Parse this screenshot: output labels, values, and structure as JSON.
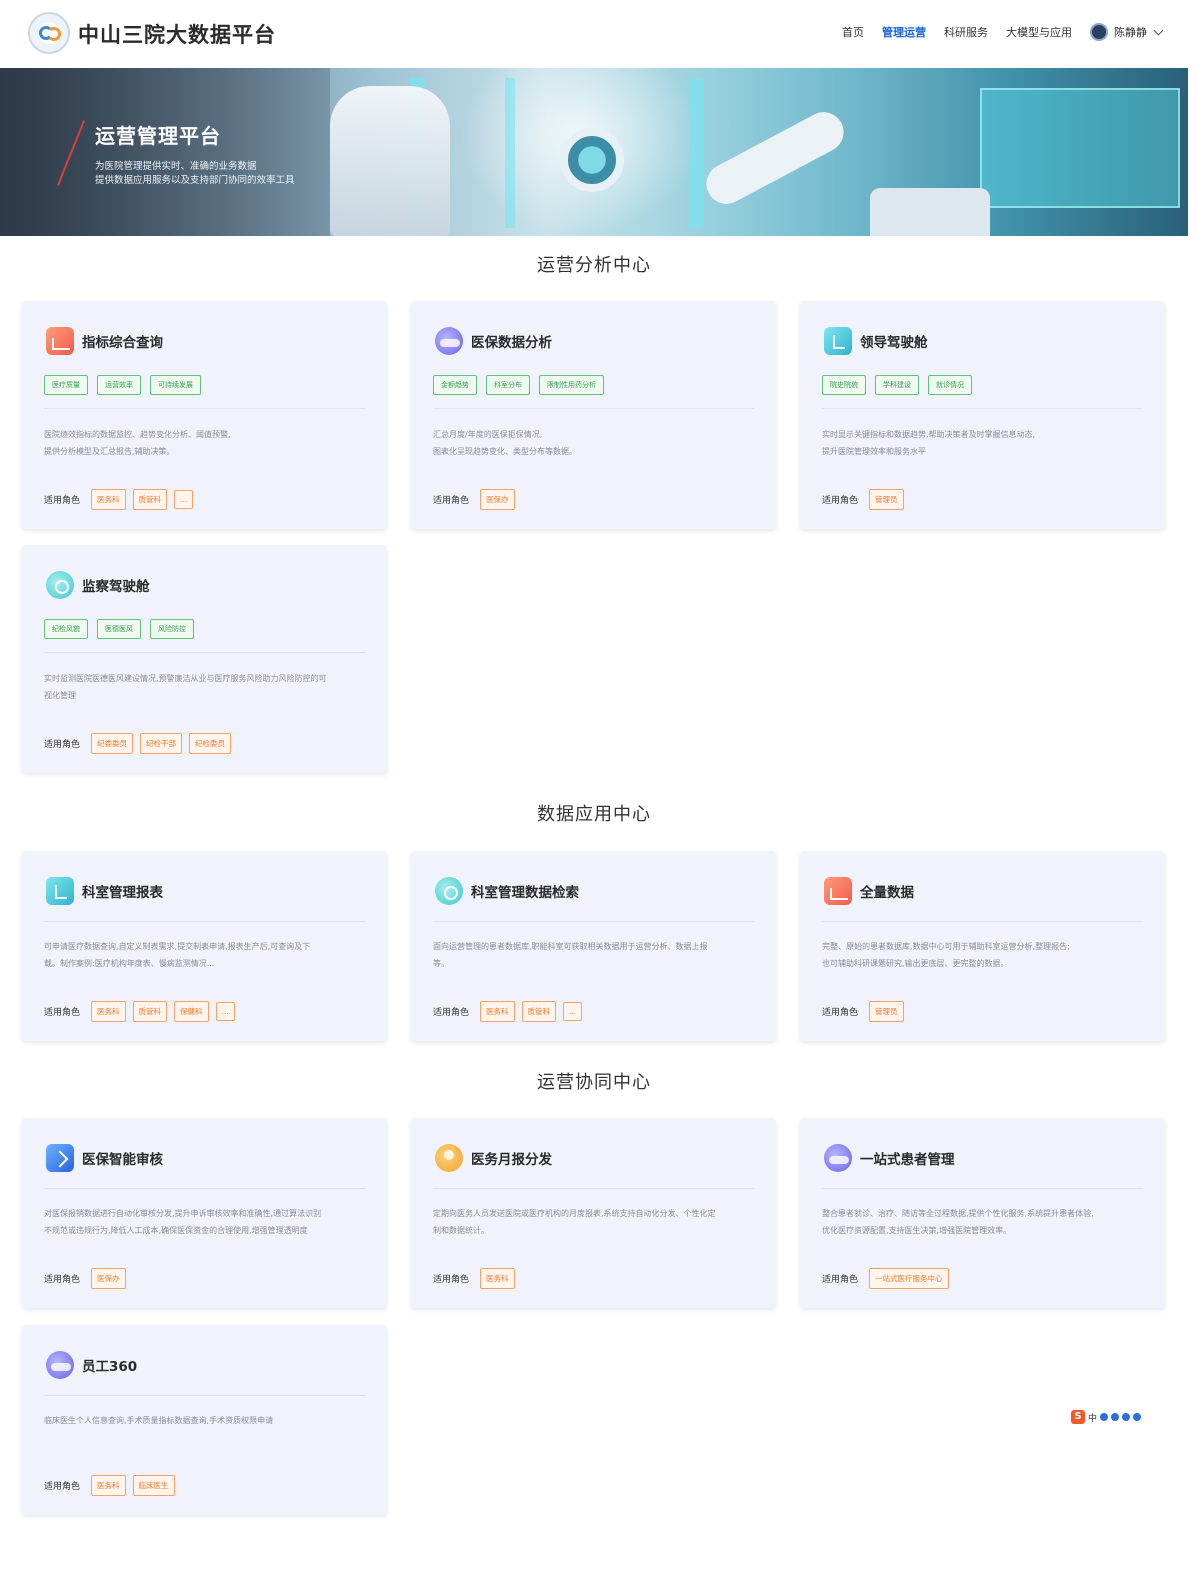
{
  "header": {
    "app_title": "中山三院大数据平台",
    "nav": [
      "首页",
      "管理运营",
      "科研服务",
      "大模型与应用"
    ],
    "active_nav": "管理运营",
    "user_name": "陈静静"
  },
  "banner": {
    "title": "运营管理平台",
    "subtitle_line1": "为医院管理提供实时、准确的业务数据",
    "subtitle_line2": "提供数据应用服务以及支持部门协同的效率工具"
  },
  "roles_label": "适用角色",
  "sections": [
    {
      "title": "运营分析中心",
      "cards": [
        {
          "icon": "chart-icon",
          "title": "指标综合查询",
          "tags": [
            "医疗质量",
            "运营效率",
            "可持续发展"
          ],
          "desc": [
            "医院绩效指标的数据监控、趋势变化分析、阈值预警,",
            "提供分析模型及汇总报告,辅助决策。"
          ],
          "roles": [
            "医务科",
            "质管科",
            "..."
          ]
        },
        {
          "icon": "cloud-icon",
          "title": "医保数据分析",
          "tags": [
            "金额趋势",
            "科室分布",
            "限制性用药分析"
          ],
          "desc": [
            "汇总月度/年度的医保拒保情况,",
            "图表化呈现趋势变化、类型分布等数据。"
          ],
          "roles": [
            "医保办"
          ]
        },
        {
          "icon": "clipboard-icon",
          "title": "领导驾驶舱",
          "tags": [
            "院史院貌",
            "学科建设",
            "就诊情况"
          ],
          "desc": [
            "实时显示关键指标和数据趋势,帮助决策者及时掌握信息动态,",
            "提升医院管理效率和服务水平"
          ],
          "roles": [
            "管理员"
          ]
        },
        {
          "icon": "teal-cloud-icon",
          "title": "监察驾驶舱",
          "tags": [
            "纪检风貌",
            "医德医风",
            "风险防控"
          ],
          "desc": [
            "实时监测医院医德医风建设情况,预警廉洁从业与医疗服务风险助力风险防控的可",
            "视化管理"
          ],
          "roles": [
            "纪委委员",
            "纪检干部",
            "纪检委员"
          ]
        }
      ]
    },
    {
      "title": "数据应用中心",
      "cards": [
        {
          "icon": "clipboard-icon",
          "title": "科室管理报表",
          "desc": [
            "可申请医疗数据查询,自定义制表需求,提交制表申请,报表生产后,可查询及下",
            "载。制作案例:医疗机构年度表、慢病监测情况..."
          ],
          "roles": [
            "医务科",
            "质管科",
            "保健科",
            "..."
          ]
        },
        {
          "icon": "teal-cloud-icon",
          "title": "科室管理数据检索",
          "desc": [
            "面向运营管理的患者数据库,职能科室可获取相关数据用于运营分析、数据上报",
            "等。"
          ],
          "roles": [
            "医务科",
            "质管科",
            "..."
          ]
        },
        {
          "icon": "chart-icon",
          "title": "全量数据",
          "desc": [
            "完整、原始的患者数据库,数据中心可用于辅助科室运营分析,整理报告;",
            "也可辅助科研课题研究,输出更底层、更完整的数据。"
          ],
          "roles": [
            "管理员"
          ]
        }
      ]
    },
    {
      "title": "运营协同中心",
      "cards": [
        {
          "icon": "blue-arrow-icon",
          "title": "医保智能审核",
          "desc": [
            "对医保报销数据进行自动化审核分发,提升申诉审核效率和准确性,通过算法识别",
            "不规范或违规行为,降低人工成本,确保医保资金的合理使用,增强管理透明度"
          ],
          "roles": [
            "医保办"
          ]
        },
        {
          "icon": "people-icon",
          "title": "医务月报分发",
          "desc": [
            "定期向医务人员发送医院或医疗机构的月度报表,系统支持自动化分发、个性化定",
            "制和数据统计。"
          ],
          "roles": [
            "医务科"
          ]
        },
        {
          "icon": "cloud-icon",
          "title": "一站式患者管理",
          "desc": [
            "整合患者就诊、治疗、随访等全过程数据,提供个性化服务,系统提升患者体验,",
            "优化医疗资源配置,支持医生决策,增强医院管理效率。"
          ],
          "roles": [
            "一站式医疗服务中心"
          ]
        },
        {
          "icon": "cloud-icon",
          "title": "员工360",
          "desc": [
            "临床医生个人信息查询,手术质量指标数据查询,手术资质权限申请"
          ],
          "roles": [
            "医务科",
            "临床医生"
          ]
        }
      ]
    }
  ],
  "ime_bar": {
    "label": "中"
  }
}
